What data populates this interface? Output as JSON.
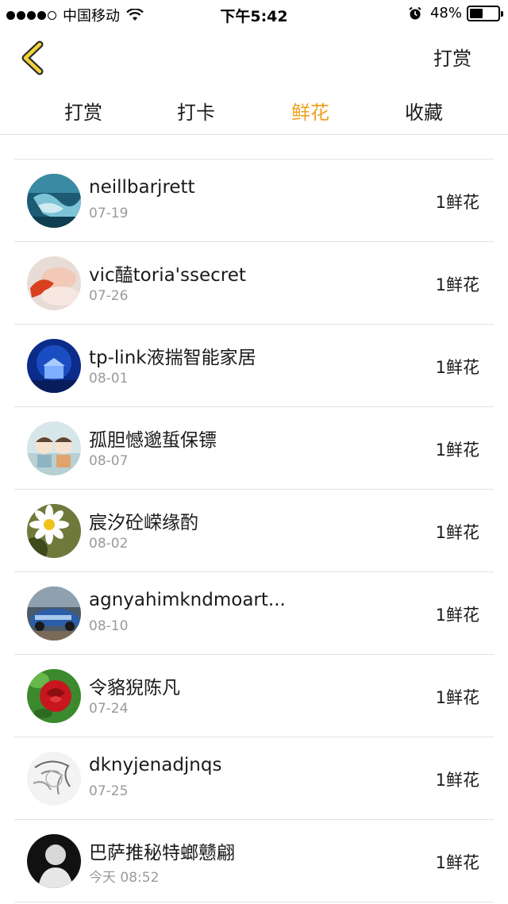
{
  "status_bar": {
    "carrier": "中国移动",
    "time": "下午5:42",
    "battery_pct": "48%",
    "battery_level": 0.48
  },
  "nav": {
    "back_icon": "chevron-left-icon",
    "action_label": "打赏",
    "accent_color": "#f0a020"
  },
  "tabs": [
    {
      "label": "打赏",
      "active": false
    },
    {
      "label": "打卡",
      "active": false
    },
    {
      "label": "鲜花",
      "active": true
    },
    {
      "label": "收藏",
      "active": false
    }
  ],
  "list": [
    {
      "name": "neillbarjrett",
      "date": "07-19",
      "amount": "1鲜花"
    },
    {
      "name": "vic醘toria'ssecret",
      "date": "07-26",
      "amount": "1鲜花"
    },
    {
      "name": "tp-link液揣智能家居",
      "date": "08-01",
      "amount": "1鲜花"
    },
    {
      "name": "孤胆憾邈蜇保镖",
      "date": "08-07",
      "amount": "1鲜花"
    },
    {
      "name": "宸汐砼嵘缘酌",
      "date": "08-02",
      "amount": "1鲜花"
    },
    {
      "name": "agnyahimkndmoart...",
      "date": "08-10",
      "amount": "1鲜花"
    },
    {
      "name": "令貉猊陈凡",
      "date": "07-24",
      "amount": "1鲜花"
    },
    {
      "name": "dknyjenadjnqs",
      "date": "07-25",
      "amount": "1鲜花"
    },
    {
      "name": "巴萨推秘特螂戆翩",
      "date": "今天 08:52",
      "amount": "1鲜花"
    }
  ]
}
